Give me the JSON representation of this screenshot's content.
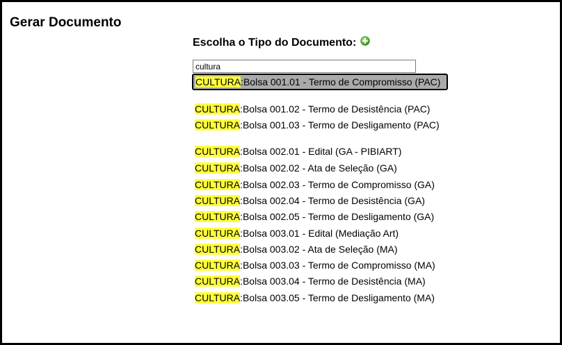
{
  "page": {
    "title": "Gerar Documento"
  },
  "form": {
    "doc_type_label": "Escolha o Tipo do Documento:",
    "add_icon": "plus-circle-icon",
    "search_value": "cultura"
  },
  "results": {
    "highlight_color": "#ffff3c",
    "selected_index": 0,
    "items": [
      {
        "match": "CULTURA",
        "rest": ":Bolsa 001.01 - Termo de Compromisso (PAC)"
      },
      {
        "match": "CULTURA",
        "rest": ":Bolsa 001.02 - Termo de Desistência (PAC)"
      },
      {
        "match": "CULTURA",
        "rest": ":Bolsa 001.03 - Termo de Desligamento (PAC)"
      },
      {
        "match": "CULTURA",
        "rest": ":Bolsa 002.01 - Edital (GA - PIBIART)"
      },
      {
        "match": "CULTURA",
        "rest": ":Bolsa 002.02 - Ata de Seleção (GA)"
      },
      {
        "match": "CULTURA",
        "rest": ":Bolsa 002.03 - Termo de Compromisso (GA)"
      },
      {
        "match": "CULTURA",
        "rest": ":Bolsa 002.04 - Termo de Desistência (GA)"
      },
      {
        "match": "CULTURA",
        "rest": ":Bolsa 002.05 - Termo de Desligamento (GA)"
      },
      {
        "match": "CULTURA",
        "rest": ":Bolsa 003.01 - Edital (Mediação Art)"
      },
      {
        "match": "CULTURA",
        "rest": ":Bolsa 003.02 - Ata de Seleção (MA)"
      },
      {
        "match": "CULTURA",
        "rest": ":Bolsa 003.03 - Termo de Compromisso (MA)"
      },
      {
        "match": "CULTURA",
        "rest": ":Bolsa 003.04 - Termo de Desistência (MA)"
      },
      {
        "match": "CULTURA",
        "rest": ":Bolsa 003.05 - Termo de Desligamento (MA)"
      }
    ]
  }
}
